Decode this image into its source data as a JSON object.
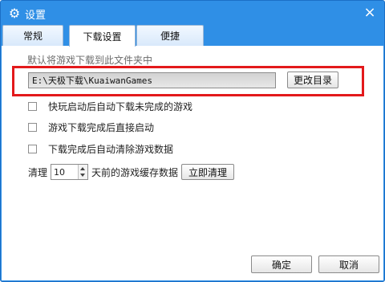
{
  "window": {
    "title": "设置",
    "icon": "gear-icon",
    "close_symbol": "×"
  },
  "tabs": [
    {
      "label": "常规",
      "active": false
    },
    {
      "label": "下载设置",
      "active": true
    },
    {
      "label": "便捷",
      "active": false
    }
  ],
  "download": {
    "default_folder_label": "默认将游戏下载到此文件夹中",
    "path_value": "E:\\天极下载\\KuaiwanGames",
    "change_dir_button": "更改目录"
  },
  "options": [
    {
      "label": "快玩启动后自动下载未完成的游戏",
      "checked": false
    },
    {
      "label": "游戏下载完成后直接启动",
      "checked": false
    },
    {
      "label": "下载完成后自动清除游戏数据",
      "checked": false
    }
  ],
  "cache": {
    "prefix": "清理",
    "days_value": "10",
    "suffix": "天前的游戏缓存数据",
    "clean_now_button": "立即清理"
  },
  "footer": {
    "ok_button": "确定",
    "cancel_button": "取消"
  },
  "colors": {
    "titlebar": "#2f8fe6",
    "highlight_border": "#e3191b"
  }
}
